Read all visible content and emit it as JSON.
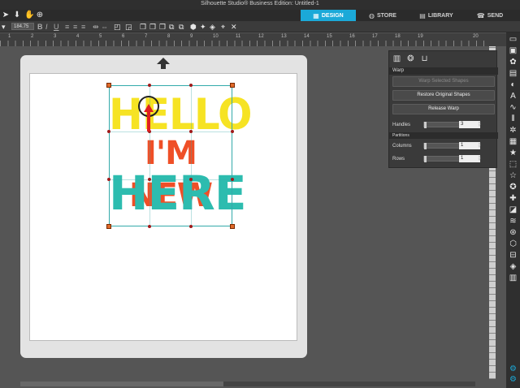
{
  "window": {
    "title": "Silhouette Studio® Business Edition: Untitled-1"
  },
  "nav": {
    "tabs": [
      {
        "label": "DESIGN",
        "icon": "grid-icon",
        "active": true
      },
      {
        "label": "STORE",
        "icon": "globe-icon",
        "active": false
      },
      {
        "label": "LIBRARY",
        "icon": "library-icon",
        "active": false
      },
      {
        "label": "SEND",
        "icon": "send-icon",
        "active": false
      }
    ]
  },
  "toolbar": {
    "font_size_value": "184.75"
  },
  "ruler": {
    "ticks": [
      "1",
      "2",
      "3",
      "4",
      "5",
      "6",
      "7",
      "8",
      "9",
      "10",
      "11",
      "12",
      "13",
      "14",
      "15",
      "16",
      "17",
      "18",
      "19",
      "20"
    ]
  },
  "canvas": {
    "words": {
      "line1": "HELLO",
      "line2": "I'M NEW",
      "line3": "HERE"
    },
    "colors": {
      "yellow": "#f6e324",
      "orange": "#ef4f27",
      "teal": "#2dbcaf"
    }
  },
  "warp_panel": {
    "title": "Warp",
    "buttons": {
      "warp_selected": "Warp Selected Shapes",
      "restore": "Restore Original Shapes",
      "release": "Release Warp"
    },
    "handles_label": "Handles",
    "handles_value": "3",
    "partitions_label": "Partitions",
    "columns_label": "Columns",
    "columns_value": "1",
    "rows_label": "Rows",
    "rows_value": "1"
  },
  "accent": "#1ba9d8"
}
